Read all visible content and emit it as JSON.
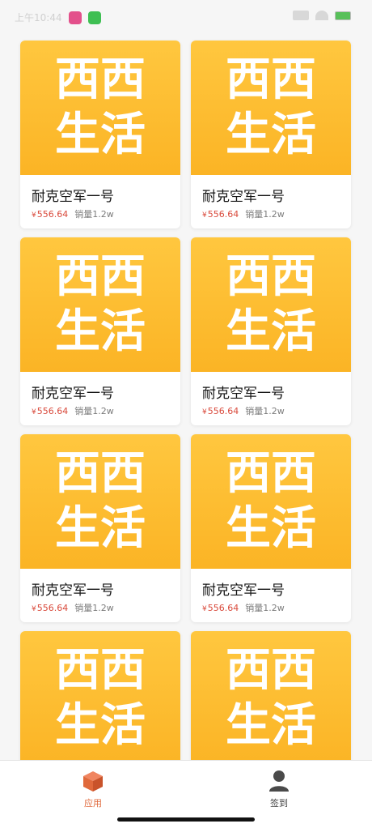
{
  "status_bar": {
    "time": "上午10:44"
  },
  "products": [
    {
      "logo_line1": "西西",
      "logo_line2": "生活",
      "title": "耐克空军一号",
      "currency": "¥",
      "price": "556.64",
      "sales": "销量1.2w"
    },
    {
      "logo_line1": "西西",
      "logo_line2": "生活",
      "title": "耐克空军一号",
      "currency": "¥",
      "price": "556.64",
      "sales": "销量1.2w"
    },
    {
      "logo_line1": "西西",
      "logo_line2": "生活",
      "title": "耐克空军一号",
      "currency": "¥",
      "price": "556.64",
      "sales": "销量1.2w"
    },
    {
      "logo_line1": "西西",
      "logo_line2": "生活",
      "title": "耐克空军一号",
      "currency": "¥",
      "price": "556.64",
      "sales": "销量1.2w"
    },
    {
      "logo_line1": "西西",
      "logo_line2": "生活",
      "title": "耐克空军一号",
      "currency": "¥",
      "price": "556.64",
      "sales": "销量1.2w"
    },
    {
      "logo_line1": "西西",
      "logo_line2": "生活",
      "title": "耐克空军一号",
      "currency": "¥",
      "price": "556.64",
      "sales": "销量1.2w"
    },
    {
      "logo_line1": "西西",
      "logo_line2": "生活",
      "title": "",
      "currency": "",
      "price": "",
      "sales": ""
    },
    {
      "logo_line1": "西西",
      "logo_line2": "生活",
      "title": "",
      "currency": "",
      "price": "",
      "sales": ""
    }
  ],
  "tabs": [
    {
      "label": "应用",
      "icon": "box-icon",
      "active": true
    },
    {
      "label": "签到",
      "icon": "user-icon",
      "active": false
    }
  ],
  "colors": {
    "accent": "#e0693b",
    "price": "#d9493b",
    "banner_top": "#ffc73f",
    "banner_bottom": "#fbb425"
  }
}
